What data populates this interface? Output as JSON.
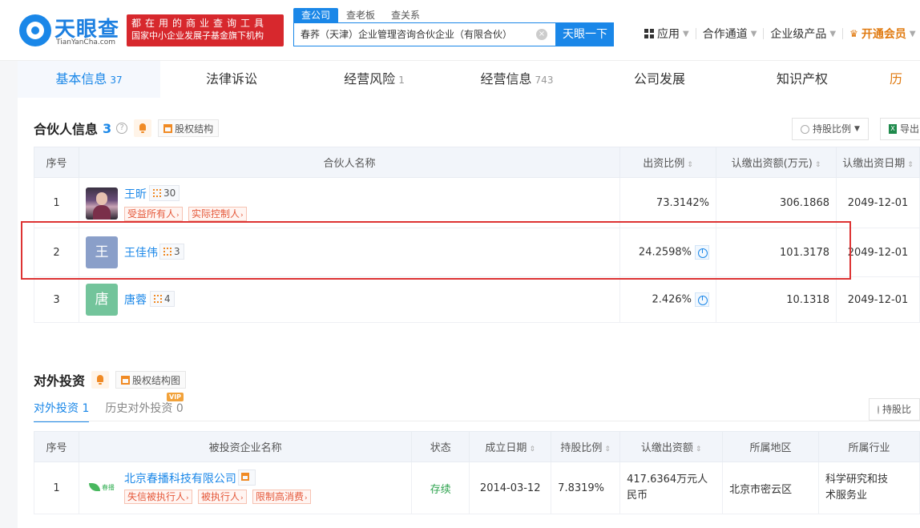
{
  "header": {
    "logo_cn": "天眼查",
    "logo_en": "TianYanCha.com",
    "slogan_line1": "都在用的商业查询工具",
    "slogan_line2": "国家中小企业发展子基金旗下机构",
    "search_tabs": [
      "查公司",
      "查老板",
      "查关系"
    ],
    "search_value": "春荞（天津）企业管理咨询合伙企业（有限合伙）",
    "search_button": "天眼一下",
    "nav": {
      "apps": "应用",
      "cooperation": "合作通道",
      "enterprise": "企业级产品",
      "vip": "开通会员"
    }
  },
  "tabs": [
    {
      "label": "基本信息",
      "count": "37"
    },
    {
      "label": "法律诉讼",
      "count": ""
    },
    {
      "label": "经营风险",
      "count": "1"
    },
    {
      "label": "经营信息",
      "count": "743"
    },
    {
      "label": "公司发展",
      "count": ""
    },
    {
      "label": "知识产权",
      "count": ""
    },
    {
      "label": "历",
      "count": ""
    }
  ],
  "partners": {
    "title": "合伙人信息",
    "count": "3",
    "help": "?",
    "structure_btn": "股权结构",
    "ratio_btn": "持股比例",
    "export_btn": "导出",
    "columns": [
      "序号",
      "合伙人名称",
      "出资比例",
      "认缴出资额(万元)",
      "认缴出资日期"
    ],
    "rows": [
      {
        "no": "1",
        "avatar": "",
        "name": "王昕",
        "holdings": "30",
        "tags": [
          "受益所有人",
          "实际控制人"
        ],
        "ratio": "73.3142%",
        "amount": "306.1868",
        "date": "2049-12-01"
      },
      {
        "no": "2",
        "avatar": "王",
        "name": "王佳伟",
        "holdings": "3",
        "tags": [],
        "ratio": "24.2598%",
        "amount": "101.3178",
        "date": "2049-12-01"
      },
      {
        "no": "3",
        "avatar": "唐",
        "name": "唐蓉",
        "holdings": "4",
        "tags": [],
        "ratio": "2.426%",
        "amount": "10.1318",
        "date": "2049-12-01"
      }
    ]
  },
  "investments": {
    "title": "对外投资",
    "structure_btn": "股权结构图",
    "sub_tabs": [
      {
        "label": "对外投资",
        "count": "1"
      },
      {
        "label": "历史对外投资",
        "count": "0"
      }
    ],
    "vip_badge": "VIP",
    "ratio_btn": "持股比",
    "columns": [
      "序号",
      "被投资企业名称",
      "状态",
      "成立日期",
      "持股比例",
      "认缴出资额",
      "所属地区",
      "所属行业"
    ],
    "rows": [
      {
        "no": "1",
        "logo_text": "春播",
        "name": "北京春播科技有限公司",
        "tags": [
          "失信被执行人",
          "被执行人",
          "限制高消费"
        ],
        "status": "存续",
        "founded": "2014-03-12",
        "ratio": "7.8319%",
        "amount_l1": "417.6364万元人",
        "amount_l2": "民币",
        "region": "北京市密云区",
        "industry_l1": "科学研究和技",
        "industry_l2": "术服务业"
      }
    ]
  },
  "colors": {
    "accent": "#1a87e8",
    "highlight": "#dd3333",
    "vip": "#e07a10"
  }
}
